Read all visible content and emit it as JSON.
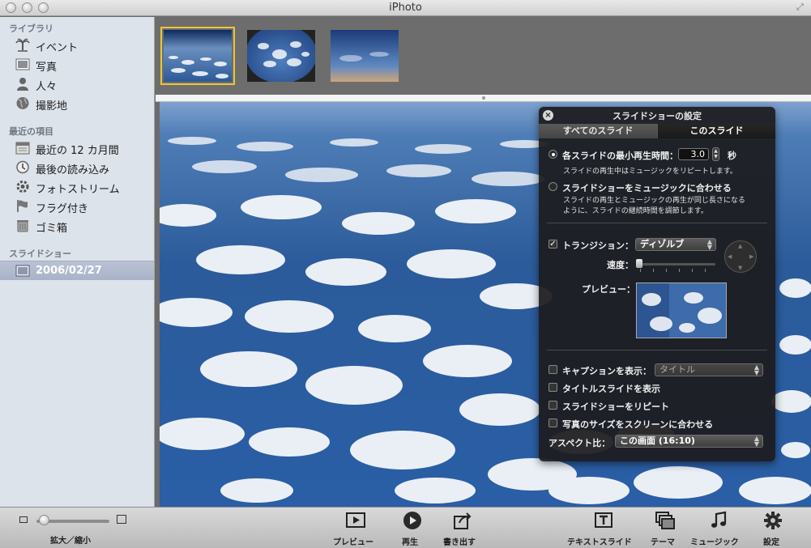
{
  "window": {
    "title": "iPhoto"
  },
  "sidebar": {
    "library_header": "ライブラリ",
    "library_items": [
      {
        "label": "イベント",
        "icon": "palm-tree-icon"
      },
      {
        "label": "写真",
        "icon": "photo-icon"
      },
      {
        "label": "人々",
        "icon": "person-icon"
      },
      {
        "label": "撮影地",
        "icon": "globe-icon"
      }
    ],
    "recent_header": "最近の項目",
    "recent_items": [
      {
        "label": "最近の 12 カ月間",
        "icon": "calendar-icon"
      },
      {
        "label": "最後の読み込み",
        "icon": "clock-icon"
      },
      {
        "label": "フォトストリーム",
        "icon": "photostream-icon"
      },
      {
        "label": "フラグ付き",
        "icon": "flag-icon"
      },
      {
        "label": "ゴミ箱",
        "icon": "trash-icon"
      }
    ],
    "slideshow_header": "スライドショー",
    "slideshow_items": [
      {
        "label": "2006/02/27",
        "icon": "slideshow-icon",
        "selected": true
      }
    ]
  },
  "settings_panel": {
    "title": "スライドショーの設定",
    "tabs": {
      "all_slides": "すべてのスライド",
      "this_slide": "このスライド"
    },
    "min_duration_label": "各スライドの最小再生時間：",
    "min_duration_value": "3.0",
    "seconds_unit": "秒",
    "repeat_music_note": "スライドの再生中はミュージックをリピートします。",
    "fit_music_label": "スライドショーをミュージックに合わせる",
    "fit_music_note_1": "スライドの再生とミュージックの再生が同じ長さになる",
    "fit_music_note_2": "ように、スライドの継続時間を調節します。",
    "transition_label": "トランジション：",
    "transition_value": "ディゾルブ",
    "speed_label": "速度：",
    "preview_label": "プレビュー：",
    "show_caption_label": "キャプションを表示：",
    "caption_value": "タイトル",
    "title_slide_label": "タイトルスライドを表示",
    "repeat_slideshow_label": "スライドショーをリピート",
    "scale_photos_label": "写真のサイズをスクリーンに合わせる",
    "aspect_label": "アスペクト比：",
    "aspect_value": "この画面 (16:10)"
  },
  "toolbar": {
    "zoom_label": "拡大／縮小",
    "preview": "プレビュー",
    "play": "再生",
    "export": "書き出す",
    "text_slide": "テキストスライド",
    "theme": "テーマ",
    "music": "ミュージック",
    "settings": "設定"
  },
  "colors": {
    "selection_outline": "#e9c73a",
    "sidebar_bg": "#dde3ea",
    "panel_bg": "#1c1c1e",
    "sky": "#2b5b9a"
  }
}
